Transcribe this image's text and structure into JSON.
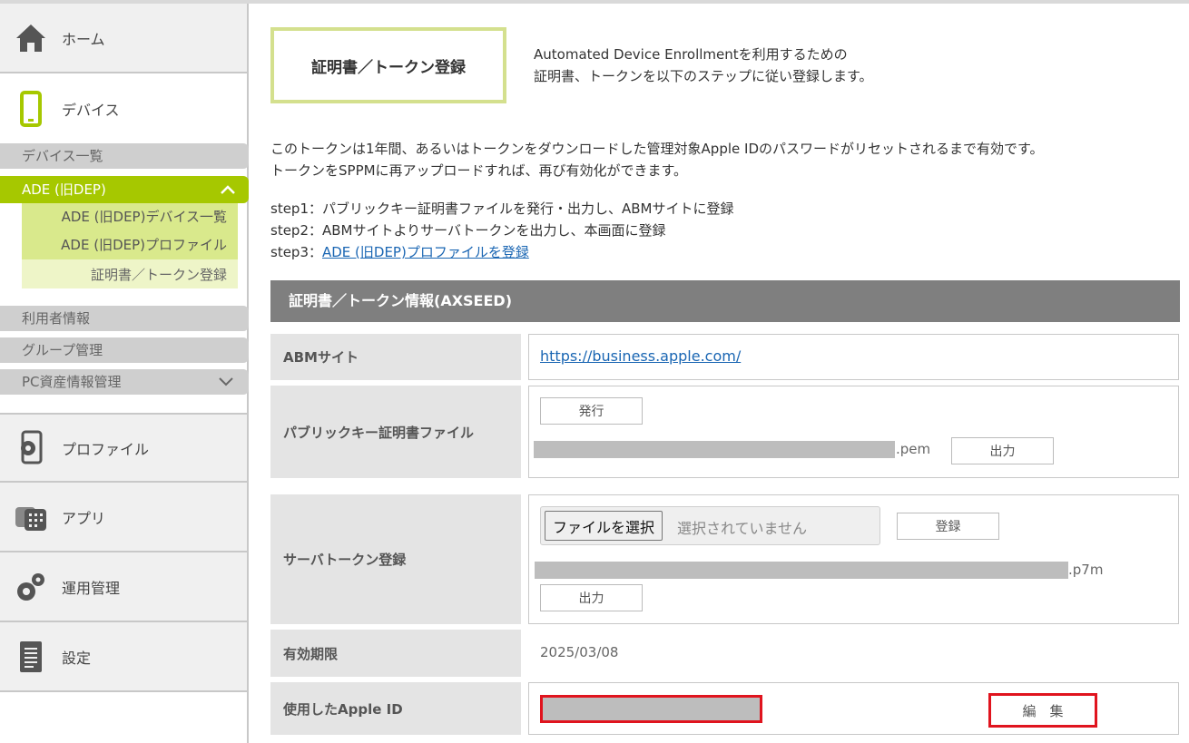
{
  "sidebar": {
    "home_label": "ホーム",
    "device_label": "デバイス",
    "device_list_label": "デバイス一覧",
    "ade_label": "ADE (旧DEP)",
    "ade_items": [
      "ADE (旧DEP)デバイス一覧",
      "ADE (旧DEP)プロファイル"
    ],
    "ade_current": "証明書／トークン登録",
    "user_info_label": "利用者情報",
    "group_label": "グループ管理",
    "pc_asset_label": "PC資産情報管理",
    "profile_label": "プロファイル",
    "app_label": "アプリ",
    "ops_label": "運用管理",
    "settings_label": "設定",
    "accent_color": "#a6c800"
  },
  "page": {
    "title": "証明書／トークン登録",
    "intro_line1": "Automated Device Enrollmentを利用するための",
    "intro_line2": "証明書、トークンを以下のステップに従い登録します。",
    "desc_line1": "このトークンは1年間、あるいはトークンをダウンロードした管理対象Apple IDのパスワードがリセットされるまで有効です。",
    "desc_line2": "トークンをSPPMに再アップロードすれば、再び有効化ができます。",
    "step1": "step1：パブリックキー証明書ファイルを発行・出力し、ABMサイトに登録",
    "step2": "step2：ABMサイトよりサーバトークンを出力し、本画面に登録",
    "step3_prefix": "step3：",
    "step3_link": "ADE (旧DEP)プロファイルを登録"
  },
  "section": {
    "title": "証明書／トークン情報(AXSEED)",
    "abm_label": "ABMサイト",
    "abm_url": "https://business.apple.com/",
    "pubkey_label": "パブリックキー証明書ファイル",
    "issue_button": "発行",
    "pem_suffix": ".pem",
    "output_button": "出力",
    "server_token_label": "サーバトークン登録",
    "file_choose_button": "ファイルを選択",
    "file_none": "選択されていません",
    "register_button": "登録",
    "p7m_suffix": ".p7m",
    "expiry_label": "有効期限",
    "expiry_value": "2025/03/08",
    "apple_id_label": "使用したApple ID",
    "edit_button": "編　集",
    "highlight_color": "#e0141e"
  }
}
